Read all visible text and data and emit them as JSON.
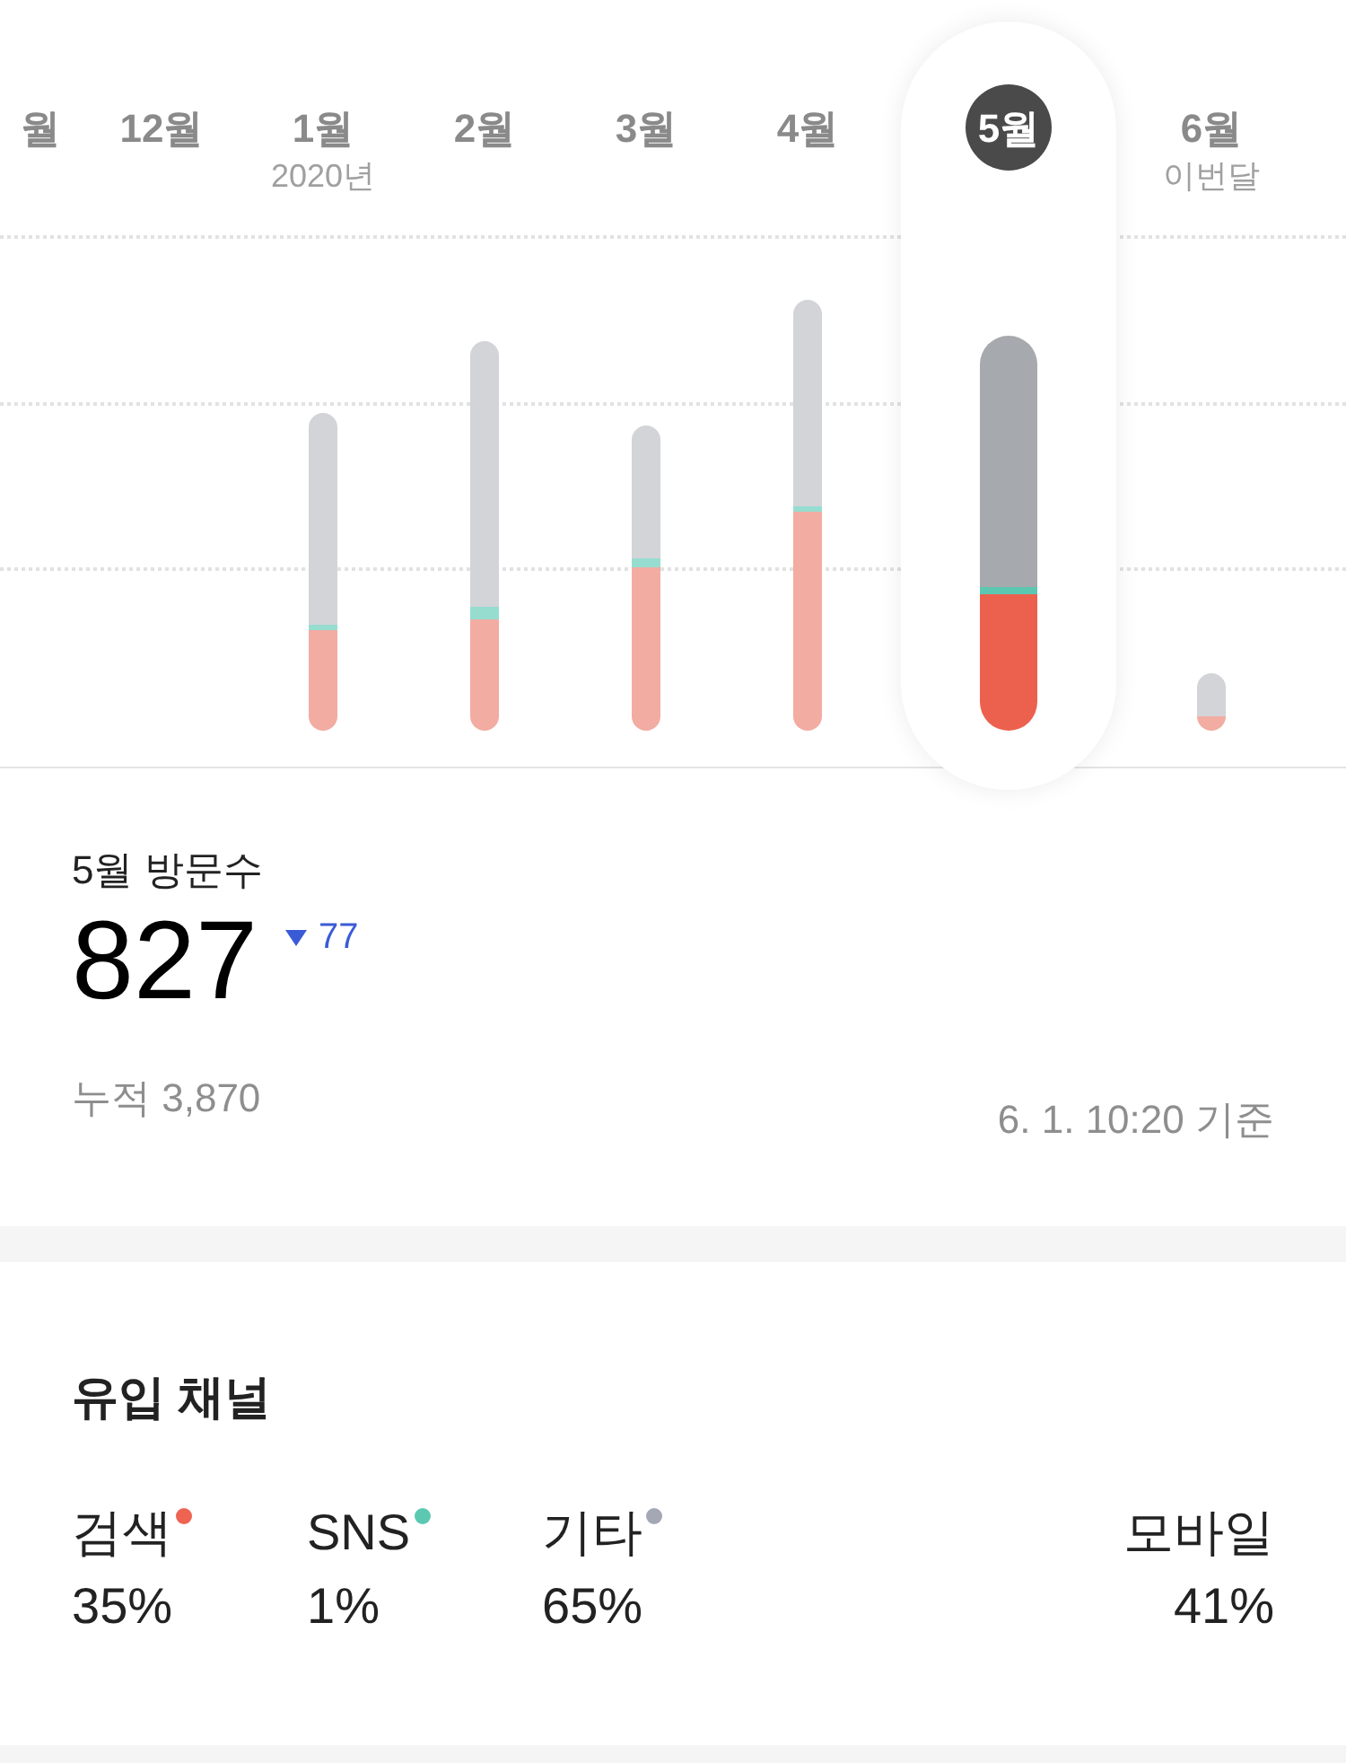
{
  "months": [
    {
      "label": "월",
      "selected": false
    },
    {
      "label": "12월",
      "selected": false
    },
    {
      "label": "1월",
      "sub": "2020년",
      "selected": false
    },
    {
      "label": "2월",
      "selected": false
    },
    {
      "label": "3월",
      "selected": false
    },
    {
      "label": "4월",
      "selected": false
    },
    {
      "label": "5월",
      "selected": true
    },
    {
      "label": "6월",
      "sub": "이번달",
      "selected": false
    }
  ],
  "visits": {
    "title": "5월 방문수",
    "value": "827",
    "change": "77",
    "total": "누적 3,870",
    "timestamp": "6. 1. 10:20 기준"
  },
  "inflow": {
    "title": "유입 채널",
    "channels": [
      {
        "label": "검색",
        "value": "35%",
        "color": "#ee6352"
      },
      {
        "label": "SNS",
        "value": "1%",
        "color": "#5cc8b2"
      },
      {
        "label": "기타",
        "value": "65%",
        "color": "#a4a8b4"
      }
    ],
    "mobile": {
      "label": "모바일",
      "value": "41%"
    }
  }
}
